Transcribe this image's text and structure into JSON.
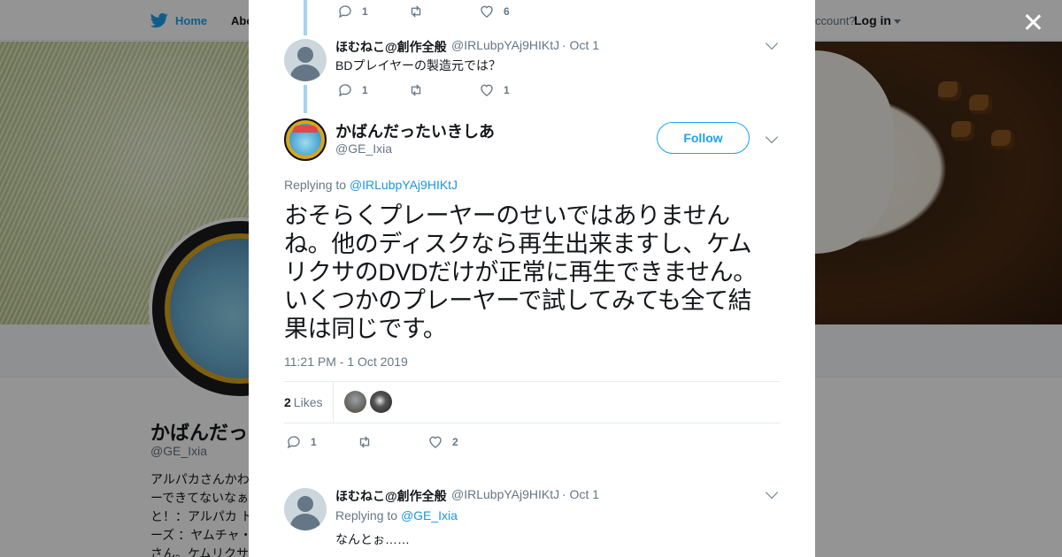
{
  "nav": {
    "home_label": "Home",
    "about_label": "Abo",
    "account_prompt": "ccount?",
    "login_label": "Log in"
  },
  "profile": {
    "name": "かばんだっ",
    "handle": "@GE_Ixia",
    "bio_lines": [
      "アルパカさんかわ",
      "ーできてないなぁ",
      "と！：アルパカ ト",
      "ーズ ：ヤムチャ・",
      "さん。ケムリクサ"
    ]
  },
  "thread": {
    "prev_tweet": {
      "reply_count": "1",
      "like_count": "6"
    },
    "parent_tweet": {
      "name": "ほむねこ@創作全般",
      "handle": "@IRLubpYAj9HIKtJ",
      "date": "· Oct 1",
      "text": "BDプレイヤーの製造元では？",
      "reply_count": "1",
      "like_count": "1"
    },
    "main_tweet": {
      "name": "かばんだったいきしあ",
      "handle": "@GE_Ixia",
      "follow_label": "Follow",
      "replying_prefix": "Replying to",
      "replying_to": "@IRLubpYAj9HIKtJ",
      "text": "おそらくプレーヤーのせいではありませんね。他のディスクなら再生出来ますし、ケムリクサのDVDだけが正常に再生できません。いくつかのプレーヤーで試してみても全て結果は同じです。",
      "timestamp": "11:21 PM - 1 Oct 2019",
      "likes_number": "2",
      "likes_label": "Likes",
      "reply_count": "1",
      "like_count": "2"
    },
    "reply_tweet": {
      "name": "ほむねこ@創作全般",
      "handle": "@IRLubpYAj9HIKtJ",
      "date": "· Oct 1",
      "replying_prefix": "Replying to",
      "replying_to": "@GE_Ixia",
      "text": "なんとぉ……"
    }
  },
  "colors": {
    "accent": "#1da1f2",
    "link": "#1b95e0",
    "thread_line": "#a3d4f2",
    "muted_text": "#657786"
  },
  "icons": [
    "twitter-bird-icon",
    "close-icon",
    "reply-icon",
    "retweet-icon",
    "heart-icon",
    "chevron-down-icon",
    "dropdown-caret-icon"
  ]
}
